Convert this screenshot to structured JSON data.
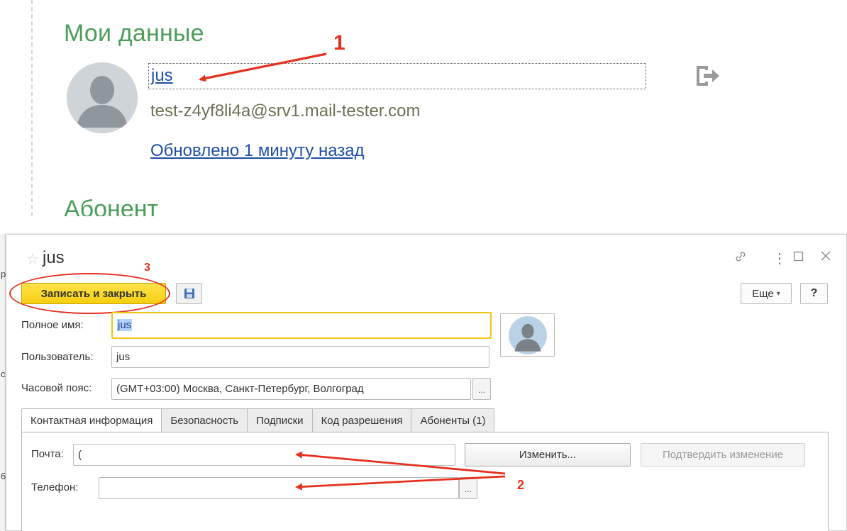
{
  "profile": {
    "heading": "Мои данные",
    "user_name": "jus",
    "email": "test-z4yf8li4a@srv1.mail-tester.com",
    "updated": "Обновлено 1 минуту назад",
    "section_next": "Абонент"
  },
  "annotations": {
    "n1": "1",
    "n2": "2",
    "n3": "3"
  },
  "form": {
    "title": "jus",
    "toolbar": {
      "save_close_label": "Записать и закрыть",
      "more_label": "Еще",
      "help_label": "?"
    },
    "fields": {
      "fullname_label": "Полное имя:",
      "fullname_value": "jus",
      "user_label": "Пользователь:",
      "user_value": "jus",
      "timezone_label": "Часовой пояс:",
      "timezone_value": "(GMT+03:00) Москва, Санкт-Петербург, Волгоград",
      "dots": "..."
    },
    "tabs": [
      {
        "label": "Контактная информация",
        "active": true
      },
      {
        "label": "Безопасность",
        "active": false
      },
      {
        "label": "Подписки",
        "active": false
      },
      {
        "label": "Код разрешения",
        "active": false
      },
      {
        "label": "Абоненты (1)",
        "active": false
      }
    ],
    "contacts": {
      "mail_label": "Почта:",
      "mail_value": "(",
      "phone_label": "Телефон:",
      "phone_value": "",
      "change_label": "Изменить...",
      "confirm_label": "Подтвердить изменение"
    }
  },
  "left_strip_chars": [
    "р",
    "с",
    "6"
  ],
  "colors": {
    "heading_green": "#4a9d5b",
    "link_blue": "#1f4ea8",
    "annotation_red": "#e5301f",
    "save_button_yellow": "#f6cf10"
  }
}
